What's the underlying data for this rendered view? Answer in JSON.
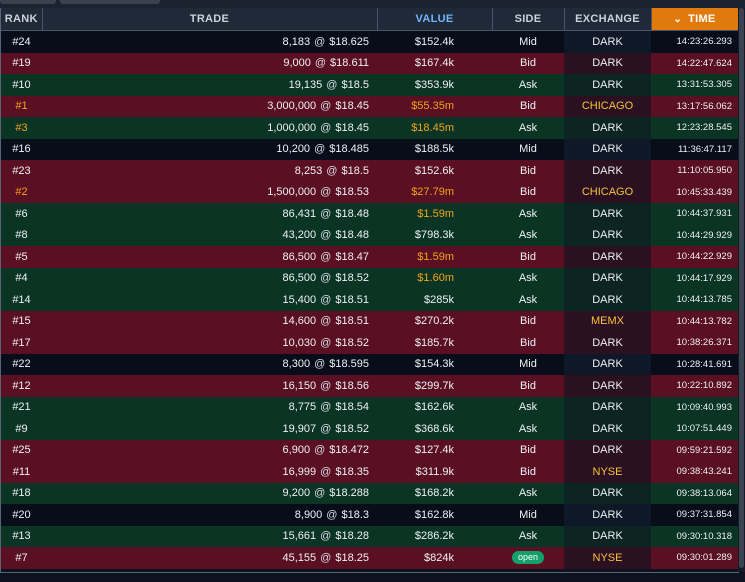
{
  "columns": {
    "rank": "RANK",
    "trade": "TRADE",
    "value": "VALUE",
    "side": "SIDE",
    "exchange": "EXCHANGE",
    "time": "TIME"
  },
  "colors": {
    "mid_row": "#070d19",
    "bid_row": "#5a0f22",
    "ask_row": "#0a3424",
    "highlight": "#f2a31b",
    "sort_header": "#e07a0c",
    "value_header": "#6fb5ff"
  },
  "rows": [
    {
      "rank": "#24",
      "qty": "8,183",
      "at": "@",
      "price": "$18.625",
      "value": "$152.4k",
      "side": "Mid",
      "exchange": "DARK",
      "time": "14:23:26.293",
      "cls": "mid",
      "hl": false
    },
    {
      "rank": "#19",
      "qty": "9,000",
      "at": "@",
      "price": "$18.611",
      "value": "$167.4k",
      "side": "Bid",
      "exchange": "DARK",
      "time": "14:22:47.624",
      "cls": "bid",
      "hl": false
    },
    {
      "rank": "#10",
      "qty": "19,135",
      "at": "@",
      "price": "$18.5",
      "value": "$353.9k",
      "side": "Ask",
      "exchange": "DARK",
      "time": "13:31:53.305",
      "cls": "ask",
      "hl": false
    },
    {
      "rank": "#1",
      "qty": "3,000,000",
      "at": "@",
      "price": "$18.45",
      "value": "$55.35m",
      "side": "Bid",
      "exchange": "CHICAGO",
      "time": "13:17:56.062",
      "cls": "bid",
      "hl": true
    },
    {
      "rank": "#3",
      "qty": "1,000,000",
      "at": "@",
      "price": "$18.45",
      "value": "$18.45m",
      "side": "Ask",
      "exchange": "DARK",
      "time": "12:23:28.545",
      "cls": "ask",
      "hl": true
    },
    {
      "rank": "#16",
      "qty": "10,200",
      "at": "@",
      "price": "$18.485",
      "value": "$188.5k",
      "side": "Mid",
      "exchange": "DARK",
      "time": "11:36:47.117",
      "cls": "mid",
      "hl": false
    },
    {
      "rank": "#23",
      "qty": "8,253",
      "at": "@",
      "price": "$18.5",
      "value": "$152.6k",
      "side": "Bid",
      "exchange": "DARK",
      "time": "11:10:05.950",
      "cls": "bid",
      "hl": false
    },
    {
      "rank": "#2",
      "qty": "1,500,000",
      "at": "@",
      "price": "$18.53",
      "value": "$27.79m",
      "side": "Bid",
      "exchange": "CHICAGO",
      "time": "10:45:33.439",
      "cls": "bid",
      "hl": true
    },
    {
      "rank": "#6",
      "qty": "86,431",
      "at": "@",
      "price": "$18.48",
      "value": "$1.59m",
      "side": "Ask",
      "exchange": "DARK",
      "time": "10:44:37.931",
      "cls": "ask",
      "hl": true,
      "hlValueOnly": true
    },
    {
      "rank": "#8",
      "qty": "43,200",
      "at": "@",
      "price": "$18.48",
      "value": "$798.3k",
      "side": "Ask",
      "exchange": "DARK",
      "time": "10:44:29.929",
      "cls": "ask",
      "hl": false
    },
    {
      "rank": "#5",
      "qty": "86,500",
      "at": "@",
      "price": "$18.47",
      "value": "$1.59m",
      "side": "Bid",
      "exchange": "DARK",
      "time": "10:44:22.929",
      "cls": "bid",
      "hl": true,
      "hlValueOnly": true
    },
    {
      "rank": "#4",
      "qty": "86,500",
      "at": "@",
      "price": "$18.52",
      "value": "$1.60m",
      "side": "Ask",
      "exchange": "DARK",
      "time": "10:44:17.929",
      "cls": "ask",
      "hl": true,
      "hlValueOnly": true
    },
    {
      "rank": "#14",
      "qty": "15,400",
      "at": "@",
      "price": "$18.51",
      "value": "$285k",
      "side": "Ask",
      "exchange": "DARK",
      "time": "10:44:13.785",
      "cls": "ask",
      "hl": false
    },
    {
      "rank": "#15",
      "qty": "14,600",
      "at": "@",
      "price": "$18.51",
      "value": "$270.2k",
      "side": "Bid",
      "exchange": "MEMX",
      "time": "10:44:13.782",
      "cls": "bid",
      "hl": false
    },
    {
      "rank": "#17",
      "qty": "10,030",
      "at": "@",
      "price": "$18.52",
      "value": "$185.7k",
      "side": "Bid",
      "exchange": "DARK",
      "time": "10:38:26.371",
      "cls": "bid",
      "hl": false
    },
    {
      "rank": "#22",
      "qty": "8,300",
      "at": "@",
      "price": "$18.595",
      "value": "$154.3k",
      "side": "Mid",
      "exchange": "DARK",
      "time": "10:28:41.691",
      "cls": "mid",
      "hl": false
    },
    {
      "rank": "#12",
      "qty": "16,150",
      "at": "@",
      "price": "$18.56",
      "value": "$299.7k",
      "side": "Bid",
      "exchange": "DARK",
      "time": "10:22:10.892",
      "cls": "bid",
      "hl": false
    },
    {
      "rank": "#21",
      "qty": "8,775",
      "at": "@",
      "price": "$18.54",
      "value": "$162.6k",
      "side": "Ask",
      "exchange": "DARK",
      "time": "10:09:40.993",
      "cls": "ask",
      "hl": false
    },
    {
      "rank": "#9",
      "qty": "19,907",
      "at": "@",
      "price": "$18.52",
      "value": "$368.6k",
      "side": "Ask",
      "exchange": "DARK",
      "time": "10:07:51.449",
      "cls": "ask",
      "hl": false
    },
    {
      "rank": "#25",
      "qty": "6,900",
      "at": "@",
      "price": "$18.472",
      "value": "$127.4k",
      "side": "Bid",
      "exchange": "DARK",
      "time": "09:59:21.592",
      "cls": "bid",
      "hl": false
    },
    {
      "rank": "#11",
      "qty": "16,999",
      "at": "@",
      "price": "$18.35",
      "value": "$311.9k",
      "side": "Bid",
      "exchange": "NYSE",
      "time": "09:38:43.241",
      "cls": "bid",
      "hl": false
    },
    {
      "rank": "#18",
      "qty": "9,200",
      "at": "@",
      "price": "$18.288",
      "value": "$168.2k",
      "side": "Ask",
      "exchange": "DARK",
      "time": "09:38:13.064",
      "cls": "ask",
      "hl": false
    },
    {
      "rank": "#20",
      "qty": "8,900",
      "at": "@",
      "price": "$18.3",
      "value": "$162.8k",
      "side": "Mid",
      "exchange": "DARK",
      "time": "09:37:31.854",
      "cls": "mid",
      "hl": false
    },
    {
      "rank": "#13",
      "qty": "15,661",
      "at": "@",
      "price": "$18.28",
      "value": "$286.2k",
      "side": "Ask",
      "exchange": "DARK",
      "time": "09:30:10.318",
      "cls": "ask",
      "hl": false
    },
    {
      "rank": "#7",
      "qty": "45,155",
      "at": "@",
      "price": "$18.25",
      "value": "$824k",
      "side": "open",
      "exchange": "NYSE",
      "time": "09:30:01.289",
      "cls": "bid",
      "hl": false,
      "sidePill": true
    }
  ]
}
